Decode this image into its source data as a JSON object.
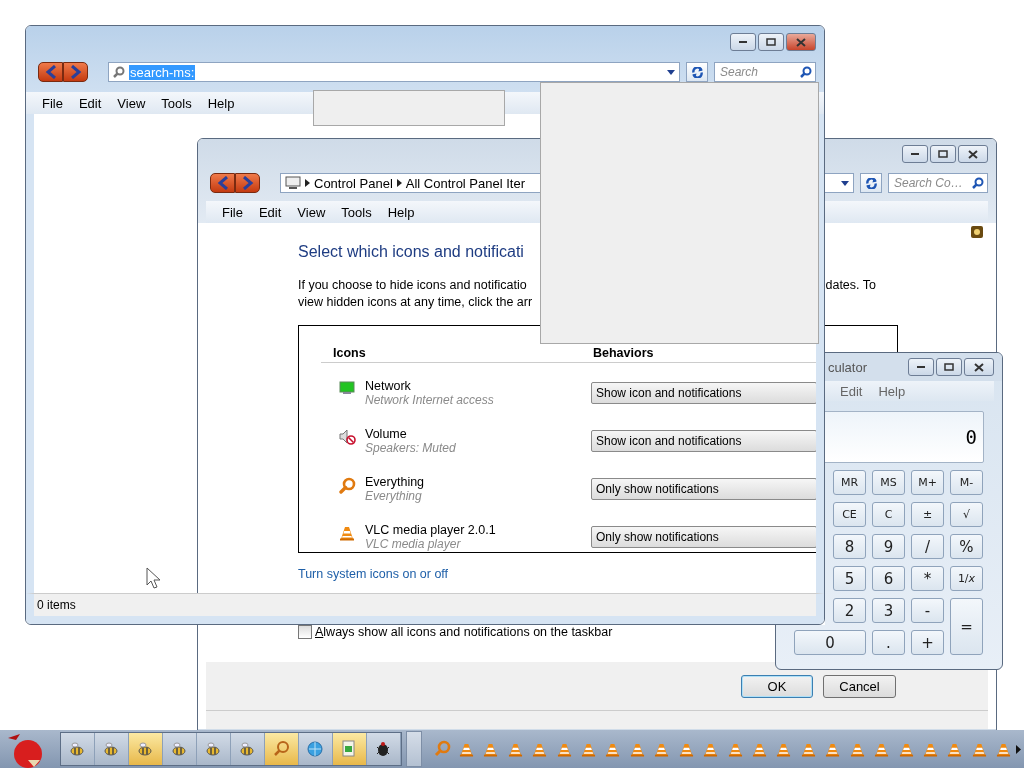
{
  "explorer": {
    "active": true,
    "address": "search-ms:",
    "address_selected": true,
    "search_placeholder": "Search",
    "menu": [
      "File",
      "Edit",
      "View",
      "Tools",
      "Help"
    ],
    "status": "0 items"
  },
  "control_panel": {
    "active": false,
    "breadcrumb": [
      "Control Panel",
      "All Control Panel Iter"
    ],
    "search_placeholder": "Search Co…",
    "menu": [
      "File",
      "Edit",
      "View",
      "Tools",
      "Help"
    ],
    "heading": "Select which icons and notificati",
    "intro_left": [
      "If you choose to hide icons and notificatio",
      "view hidden icons at any time, click the arr"
    ],
    "intro_right": "dates. To",
    "columns": [
      "Icons",
      "Behaviors"
    ],
    "rows": [
      {
        "kind": "network",
        "name": "Network",
        "detail": "Network Internet access",
        "behavior": "Show icon and notifications"
      },
      {
        "kind": "volume",
        "name": "Volume",
        "detail": "Speakers: Muted",
        "behavior": "Show icon and notifications"
      },
      {
        "kind": "search",
        "name": "Everything",
        "detail": "Everything",
        "behavior": "Only show notifications"
      },
      {
        "kind": "cone",
        "name": "VLC media player 2.0.1",
        "detail": "VLC media player",
        "behavior": "Only show notifications"
      }
    ],
    "link": "Turn system icons on or off",
    "checkbox": {
      "label": "Always show all icons and notifications on the taskbar",
      "checked": false
    },
    "buttons": [
      "OK",
      "Cancel"
    ]
  },
  "calculator": {
    "active": false,
    "title": "culator",
    "menu": [
      "Edit",
      "Help"
    ],
    "display": "0",
    "keys": [
      [
        "MR",
        "MS",
        "M+",
        "M-"
      ],
      [
        "CE",
        "C",
        "±",
        "√"
      ],
      [
        "8",
        "9",
        "/",
        "%"
      ],
      [
        "5",
        "6",
        "*",
        "1/*x*"
      ],
      [
        "2",
        "3",
        "-",
        "="
      ],
      [
        "0",
        ".",
        "+"
      ]
    ]
  },
  "taskbar": {
    "buttons": [
      {
        "kind": "app",
        "active": false
      },
      {
        "kind": "app",
        "active": false
      },
      {
        "kind": "app",
        "active": true
      },
      {
        "kind": "app",
        "active": false
      },
      {
        "kind": "app",
        "active": false
      },
      {
        "kind": "app",
        "active": false
      },
      {
        "kind": "search",
        "active": true
      },
      {
        "kind": "globe",
        "active": false
      },
      {
        "kind": "document",
        "active": true
      },
      {
        "kind": "bug",
        "active": false
      }
    ],
    "tray": [
      {
        "kind": "search"
      },
      {
        "kind": "cone"
      },
      {
        "kind": "cone"
      },
      {
        "kind": "cone"
      },
      {
        "kind": "cone"
      },
      {
        "kind": "cone"
      },
      {
        "kind": "cone"
      },
      {
        "kind": "cone"
      },
      {
        "kind": "cone"
      },
      {
        "kind": "cone"
      },
      {
        "kind": "cone"
      },
      {
        "kind": "cone"
      },
      {
        "kind": "cone"
      },
      {
        "kind": "cone"
      },
      {
        "kind": "cone"
      },
      {
        "kind": "cone"
      },
      {
        "kind": "cone"
      },
      {
        "kind": "cone"
      },
      {
        "kind": "cone"
      },
      {
        "kind": "cone"
      },
      {
        "kind": "cone"
      },
      {
        "kind": "cone"
      },
      {
        "kind": "cone"
      },
      {
        "kind": "cone"
      }
    ]
  }
}
